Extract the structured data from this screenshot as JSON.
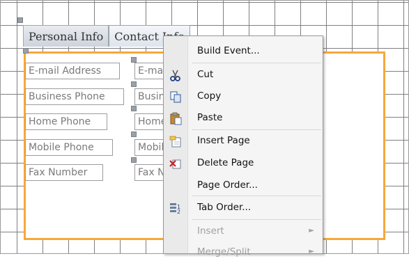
{
  "tabs": [
    {
      "label": "Personal Info"
    },
    {
      "label": "Contact Info"
    }
  ],
  "left_fields": [
    "E-mail Address",
    "Business Phone",
    "Home Phone",
    "Mobile Phone",
    "Fax Number"
  ],
  "right_fields": [
    "E-mail Address",
    "Business Phone",
    "Home Phone",
    "Mobile Phone",
    "Fax Number"
  ],
  "context_menu": {
    "items": [
      {
        "label": "Build Event...",
        "icon": null,
        "enabled": true
      },
      {
        "label": "Cut",
        "icon": "scissors-icon",
        "enabled": true
      },
      {
        "label": "Copy",
        "icon": "copy-icon",
        "enabled": true
      },
      {
        "label": "Paste",
        "icon": "paste-icon",
        "enabled": true
      },
      {
        "label": "Insert Page",
        "icon": "insert-page-icon",
        "enabled": true
      },
      {
        "label": "Delete Page",
        "icon": "delete-page-icon",
        "enabled": true
      },
      {
        "label": "Page Order...",
        "icon": null,
        "enabled": true
      },
      {
        "label": "Tab Order...",
        "icon": "tab-order-icon",
        "enabled": true
      },
      {
        "label": "Insert",
        "icon": null,
        "enabled": false,
        "submenu": true
      },
      {
        "label": "Merge/Split",
        "icon": null,
        "enabled": false,
        "submenu": true
      }
    ]
  },
  "colors": {
    "selection_border": "#f6a83a",
    "grid": "#7f7f7f"
  }
}
